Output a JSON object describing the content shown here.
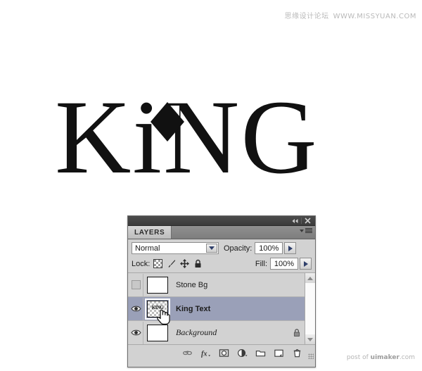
{
  "watermark": {
    "cn": "思缘设计论坛",
    "url": "WWW.MISSYUAN.COM"
  },
  "artwork": {
    "word": "KiNG"
  },
  "panel": {
    "titlebar": {
      "collapse_label": "◀◀",
      "close_label": "✕"
    },
    "tab_label": "LAYERS",
    "blend": {
      "mode": "Normal",
      "opacity_label": "Opacity:",
      "opacity_value": "100%"
    },
    "lock": {
      "label": "Lock:",
      "fill_label": "Fill:",
      "fill_value": "100%",
      "icons": [
        "lock-transparency-icon",
        "lock-image-icon",
        "lock-position-icon",
        "lock-all-icon"
      ]
    },
    "layers": [
      {
        "name": "Stone Bg",
        "visible": false,
        "selected": false,
        "locked": false,
        "italic": false,
        "bold": false,
        "thumb": "white",
        "thumb_text": ""
      },
      {
        "name": "King Text",
        "visible": true,
        "selected": true,
        "locked": false,
        "italic": false,
        "bold": true,
        "thumb": "checker",
        "thumb_text": "KING"
      },
      {
        "name": "Background",
        "visible": true,
        "selected": false,
        "locked": true,
        "italic": true,
        "bold": false,
        "thumb": "white",
        "thumb_text": ""
      }
    ],
    "bottom_icons": [
      "link-layers-icon",
      "layer-style-fx-icon",
      "layer-mask-icon",
      "adjustment-layer-icon",
      "new-group-icon",
      "new-layer-icon",
      "delete-layer-icon"
    ]
  },
  "credit": {
    "prefix": "post of ",
    "brand": "uimaker",
    "suffix": ".com"
  },
  "colors": {
    "panel_bg": "#d2d2d2",
    "selected_row": "#9aa0b8",
    "titlebar": "#3b3b3b",
    "text": "#1c1c1c",
    "watermark": "#b9b9b9"
  }
}
